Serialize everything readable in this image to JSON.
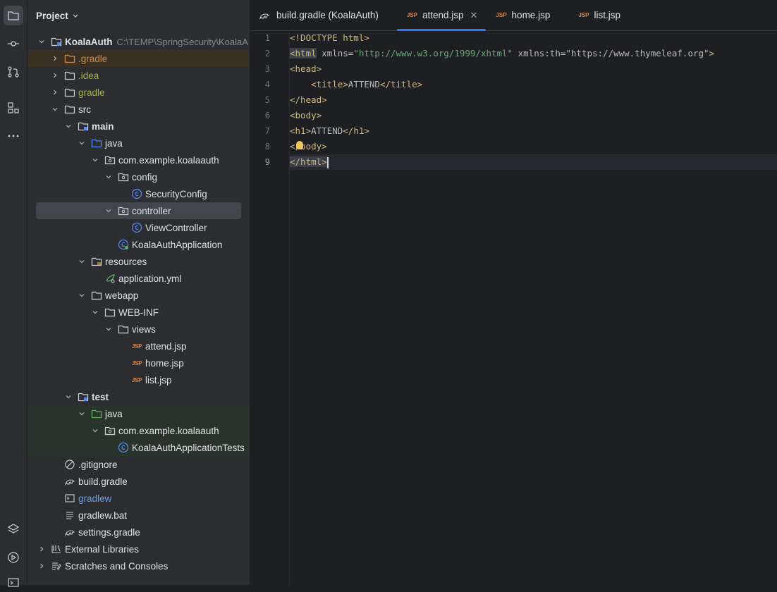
{
  "project_panel": {
    "title": "Project"
  },
  "tree": [
    {
      "label": "KoalaAuth",
      "hint": "C:\\TEMP\\SpringSecurity\\KoalaA",
      "depth": 0,
      "arrow": "down",
      "icon": "module-folder",
      "style": "bold"
    },
    {
      "label": ".gradle",
      "depth": 1,
      "arrow": "right",
      "icon": "folder-orange",
      "style": "orange",
      "hl": "orange"
    },
    {
      "label": ".idea",
      "depth": 1,
      "arrow": "right",
      "icon": "folder",
      "style": "olive"
    },
    {
      "label": "gradle",
      "depth": 1,
      "arrow": "right",
      "icon": "folder",
      "style": "olive"
    },
    {
      "label": "src",
      "depth": 1,
      "arrow": "down",
      "icon": "folder"
    },
    {
      "label": "main",
      "depth": 2,
      "arrow": "down",
      "icon": "module-folder",
      "style": "bold"
    },
    {
      "label": "java",
      "depth": 3,
      "arrow": "down",
      "icon": "source-folder"
    },
    {
      "label": "com.example.koalaauth",
      "depth": 4,
      "arrow": "down",
      "icon": "package"
    },
    {
      "label": "config",
      "depth": 5,
      "arrow": "down",
      "icon": "package"
    },
    {
      "label": "SecurityConfig",
      "depth": 6,
      "icon": "class"
    },
    {
      "label": "controller",
      "depth": 5,
      "arrow": "down",
      "icon": "package",
      "selected": true
    },
    {
      "label": "ViewController",
      "depth": 6,
      "icon": "class"
    },
    {
      "label": "KoalaAuthApplication",
      "depth": 5,
      "icon": "spring-class"
    },
    {
      "label": "resources",
      "depth": 3,
      "arrow": "down",
      "icon": "resources-folder"
    },
    {
      "label": "application.yml",
      "depth": 4,
      "icon": "yml"
    },
    {
      "label": "webapp",
      "depth": 3,
      "arrow": "down",
      "icon": "folder"
    },
    {
      "label": "WEB-INF",
      "depth": 4,
      "arrow": "down",
      "icon": "folder"
    },
    {
      "label": "views",
      "depth": 5,
      "arrow": "down",
      "icon": "folder"
    },
    {
      "label": "attend.jsp",
      "depth": 6,
      "icon": "jsp"
    },
    {
      "label": "home.jsp",
      "depth": 6,
      "icon": "jsp"
    },
    {
      "label": "list.jsp",
      "depth": 6,
      "icon": "jsp"
    },
    {
      "label": "test",
      "depth": 2,
      "arrow": "down",
      "icon": "module-folder",
      "style": "bold"
    },
    {
      "label": "java",
      "depth": 3,
      "arrow": "down",
      "icon": "test-folder",
      "hl": "green"
    },
    {
      "label": "com.example.koalaauth",
      "depth": 4,
      "arrow": "down",
      "icon": "package",
      "hl": "green"
    },
    {
      "label": "KoalaAuthApplicationTests",
      "depth": 5,
      "icon": "class",
      "hl": "green"
    },
    {
      "label": ".gitignore",
      "depth": 1,
      "icon": "ignore"
    },
    {
      "label": "build.gradle",
      "depth": 1,
      "icon": "gradle"
    },
    {
      "label": "gradlew",
      "depth": 1,
      "icon": "terminal",
      "style": "blue"
    },
    {
      "label": "gradlew.bat",
      "depth": 1,
      "icon": "text-file"
    },
    {
      "label": "settings.gradle",
      "depth": 1,
      "icon": "gradle"
    },
    {
      "label": "External Libraries",
      "depth": 0,
      "arrow": "right",
      "icon": "libraries"
    },
    {
      "label": "Scratches and Consoles",
      "depth": 0,
      "arrow": "right",
      "icon": "scratches"
    }
  ],
  "tabs": [
    {
      "label": "build.gradle (KoalaAuth)",
      "icon": "gradle"
    },
    {
      "label": "attend.jsp",
      "icon": "jsp",
      "active": true,
      "closable": true
    },
    {
      "label": "home.jsp",
      "icon": "jsp"
    },
    {
      "label": "list.jsp",
      "icon": "jsp"
    }
  ],
  "editor": {
    "current_line": 9,
    "line_numbers": [
      "1",
      "2",
      "3",
      "4",
      "5",
      "6",
      "7",
      "8",
      "9"
    ],
    "lines": [
      [
        {
          "t": "<!DOCTYPE html>",
          "c": "tag"
        }
      ],
      [
        {
          "t": "<html",
          "c": "tag tagbg"
        },
        {
          "t": " xmlns=",
          "c": "attr"
        },
        {
          "t": "\"http://www.w3.org/1999/xhtml\"",
          "c": "str"
        },
        {
          "t": " xmlns:th=\"https://www.thymeleaf.org\"",
          "c": "attr"
        },
        {
          "t": ">",
          "c": "tag"
        }
      ],
      [
        {
          "t": "<head>",
          "c": "tag"
        }
      ],
      [
        {
          "t": "    ",
          "c": "txt"
        },
        {
          "t": "<title>",
          "c": "tag"
        },
        {
          "t": "ATTEND",
          "c": "txt"
        },
        {
          "t": "</title>",
          "c": "tag"
        }
      ],
      [
        {
          "t": "</head>",
          "c": "tag"
        }
      ],
      [
        {
          "t": "<body>",
          "c": "tag"
        }
      ],
      [
        {
          "t": "<h1>",
          "c": "tag"
        },
        {
          "t": "ATTEND",
          "c": "txt"
        },
        {
          "t": "</h1>",
          "c": "tag"
        }
      ],
      [
        {
          "t": "</body>",
          "c": "tag"
        }
      ],
      [
        {
          "t": "</html>",
          "c": "tag tagbg"
        }
      ]
    ]
  },
  "toolstrip": [
    {
      "name": "project-icon",
      "active": true
    },
    {
      "name": "commit-icon"
    },
    {
      "name": "pull-requests-icon"
    },
    {
      "name": "structure-icon"
    },
    {
      "name": "more-icon"
    },
    {
      "name": "layers-icon"
    },
    {
      "name": "run-icon"
    },
    {
      "name": "terminal-tool-icon"
    }
  ]
}
